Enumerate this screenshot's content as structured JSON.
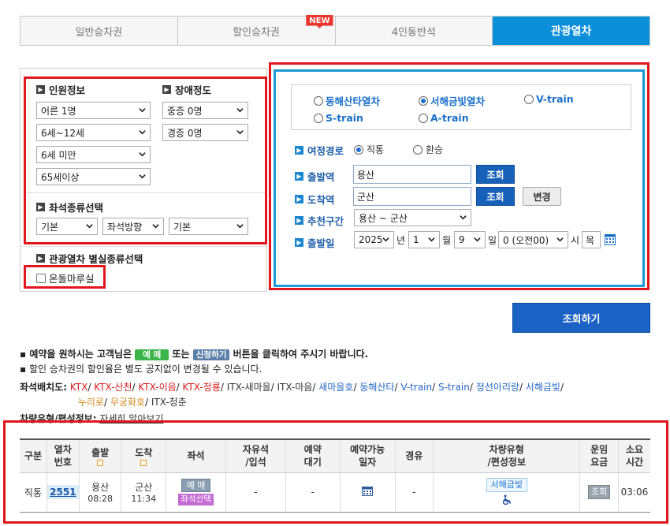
{
  "tabs": [
    {
      "label": "일반승차권"
    },
    {
      "label": "할인승차권",
      "badge": "NEW"
    },
    {
      "label": "4인동반석"
    },
    {
      "label": "관광열차"
    }
  ],
  "passenger": {
    "title": "인원정보",
    "selects": [
      "어른 1명",
      "6세~12세",
      "6세 미만",
      "65세이상"
    ]
  },
  "disability": {
    "title": "장애정도",
    "selects": [
      "중증 0명",
      "경증 0명"
    ]
  },
  "seat_type": {
    "title": "좌석종류선택",
    "selects": [
      "기본",
      "좌석방향",
      "기본"
    ]
  },
  "tour_seat": {
    "title": "관광열차 별실종류선택",
    "checkbox_label": "온돌마루실"
  },
  "train_options": [
    {
      "label": "동해산타열차",
      "selected": false
    },
    {
      "label": "서해금빛열차",
      "selected": true
    },
    {
      "label": "V-train",
      "selected": false
    },
    {
      "label": "S-train",
      "selected": false
    },
    {
      "label": "A-train",
      "selected": false
    }
  ],
  "route": {
    "label": "여정경로",
    "direct": "직통",
    "transfer": "환승"
  },
  "departure": {
    "label": "출발역",
    "value": "용산",
    "button": "조회"
  },
  "arrival": {
    "label": "도착역",
    "value": "군산",
    "button": "조회",
    "change_button": "변경"
  },
  "recommended": {
    "label": "추천구간",
    "value": "용산 ~ 군산"
  },
  "date": {
    "label": "출발일",
    "year": "2025",
    "year_unit": "년",
    "month": "1",
    "month_unit": "월",
    "day": "9",
    "day_unit": "일",
    "hour": "0 (오전00)",
    "hour_unit": "시",
    "weekday": "목"
  },
  "search_button": "조회하기",
  "notices": {
    "line1_pre": "예약을 원하시는 고객님은",
    "tag_reserve": "예 매",
    "line1_mid": "또는",
    "tag_apply": "신청하기",
    "line1_post": "버튼을 클릭하여 주시기 바랍니다.",
    "line2": "할인 승차권의 할인율은 별도 공지없이 변경될 수 있습니다."
  },
  "seat_map": {
    "label": "좌석배치도:",
    "links_red": [
      "KTX",
      "KTX-산천",
      "KTX-이음",
      "KTX-청룡"
    ],
    "links_dark": [
      "ITX-새마을",
      "ITX-마음"
    ],
    "links_blue": [
      "새마을호",
      "동해산타",
      "V-train",
      "S-train",
      "정선아리랑",
      "서해금빛"
    ],
    "links_orange": [
      "누리로",
      "무궁화호"
    ],
    "links_dark2": [
      "ITX-청춘"
    ]
  },
  "vehicle_info": {
    "label": "차량유형/편성정보:",
    "link": "자세히 알아보기"
  },
  "table": {
    "headers": [
      "구분",
      "열차\n번호",
      "출발",
      "도착",
      "좌석",
      "자유석\n/입석",
      "예약\n대기",
      "예약가능\n일자",
      "경유",
      "차량유형\n/편성정보",
      "운임\n요금",
      "소요\n시간"
    ],
    "rows": [
      {
        "type": "직통",
        "train_no": "2551",
        "dep_station": "용산",
        "dep_time": "08:28",
        "arr_station": "군산",
        "arr_time": "11:34",
        "seat_btn": "예 매",
        "seat_select": "좌석선택",
        "free_seat": "-",
        "waitlist": "-",
        "via": "-",
        "train_type": "서해금빛",
        "fare_btn": "조회",
        "duration": "03:06"
      }
    ]
  }
}
